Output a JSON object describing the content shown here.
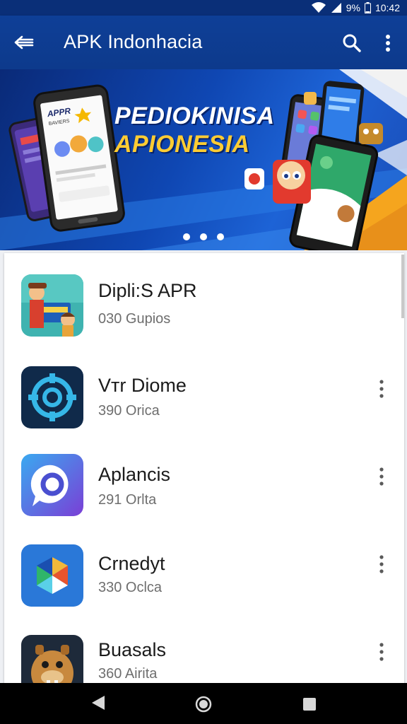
{
  "status_bar": {
    "battery_text": "9%",
    "time": "10:42",
    "icons": [
      "wifi-icon",
      "signal-icon",
      "battery-icon"
    ]
  },
  "app_bar": {
    "title": "APK Indonhacia",
    "icons": [
      "back-arrow-icon",
      "search-icon",
      "more-vert-icon"
    ]
  },
  "banner": {
    "headline_line1": "PEDIOKINISA",
    "headline_line2": "APIONESIA",
    "phone_text_1": "APPR",
    "phone_text_2": "BAVIERS",
    "page_dots": 3
  },
  "apps": [
    {
      "name": "Dipli:S APR",
      "subtitle": "030 Gupios",
      "icon": "cartoon-kids-icon",
      "has_menu": false
    },
    {
      "name": "Vтr Diome",
      "subtitle": "390 Orica",
      "icon": "gear-target-icon",
      "has_menu": true
    },
    {
      "name": "Aplancis",
      "subtitle": "291 Orlta",
      "icon": "chat-bubble-icon",
      "has_menu": true
    },
    {
      "name": "Crnedyt",
      "subtitle": "330 Oclca",
      "icon": "pinwheel-icon",
      "has_menu": true
    },
    {
      "name": "Buasals",
      "subtitle": "360 Airita",
      "icon": "walrus-character-icon",
      "has_menu": true
    }
  ],
  "colors": {
    "app_bar": "#0d3a8c",
    "status_bar": "#0a2f78",
    "banner_accent": "#ffcc33",
    "list_bg": "#ffffff",
    "nav_bar": "#000000"
  },
  "nav_bar": {
    "icons": [
      "back-triangle-icon",
      "home-circle-icon",
      "recents-square-icon"
    ]
  }
}
